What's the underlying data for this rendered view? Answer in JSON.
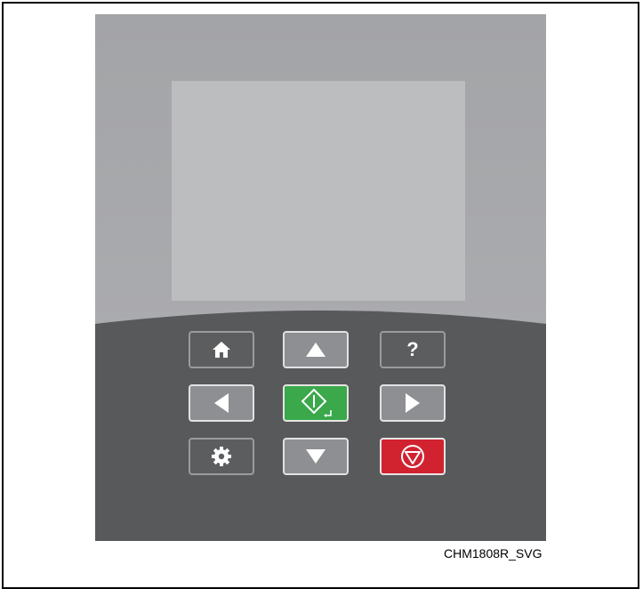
{
  "figure": {
    "caption": "CHM1808R_SVG"
  },
  "keypad": {
    "keys": [
      {
        "name": "home",
        "icon": "home-icon",
        "color": "#5c5d5f"
      },
      {
        "name": "up",
        "icon": "arrow-up-icon",
        "color": "#8e8f92"
      },
      {
        "name": "help",
        "icon": "question-icon",
        "label": "?",
        "color": "#5c5d5f"
      },
      {
        "name": "left",
        "icon": "arrow-left-icon",
        "color": "#8e8f92"
      },
      {
        "name": "start-enter",
        "icon": "start-diamond-icon",
        "color": "#3aa84b"
      },
      {
        "name": "right",
        "icon": "arrow-right-icon",
        "color": "#8e8f92"
      },
      {
        "name": "settings",
        "icon": "gear-icon",
        "color": "#5c5d5f"
      },
      {
        "name": "down",
        "icon": "arrow-down-icon",
        "color": "#8e8f92"
      },
      {
        "name": "stop",
        "icon": "stop-icon",
        "color": "#d12230"
      }
    ]
  },
  "colors": {
    "housing_top": "#a7a8ab",
    "housing_bottom": "#58595b",
    "screen": "#bcbdbf"
  }
}
